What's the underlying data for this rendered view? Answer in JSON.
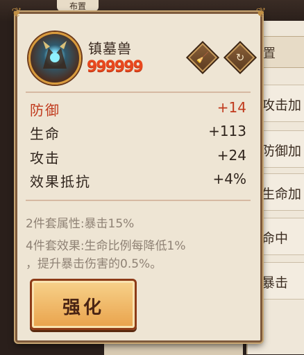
{
  "background": {
    "top_tab": "布置",
    "panel_header": "位置",
    "rows": [
      "攻击加",
      "防御加",
      "生命加",
      "命中",
      "暴击"
    ]
  },
  "card": {
    "name": "镇墓兽",
    "stars": "999999",
    "icons": [
      "broom-icon",
      "refresh-icon"
    ],
    "stats": [
      {
        "label": "防御",
        "value": "+14",
        "highlight": true
      },
      {
        "label": "生命",
        "value": "+113",
        "highlight": false
      },
      {
        "label": "攻击",
        "value": "+24",
        "highlight": false
      },
      {
        "label": "效果抵抗",
        "value": "+4%",
        "highlight": false
      }
    ],
    "set2": "2件套属性:暴击15%",
    "set4_line1": "4件套效果:生命比例每降低1%",
    "set4_line2": "，提升暴击伤害的0.5%。",
    "button_label": "强化"
  },
  "colors": {
    "highlight": "#c0391c",
    "stars": "#e8481e",
    "button": "#f0b25e"
  }
}
